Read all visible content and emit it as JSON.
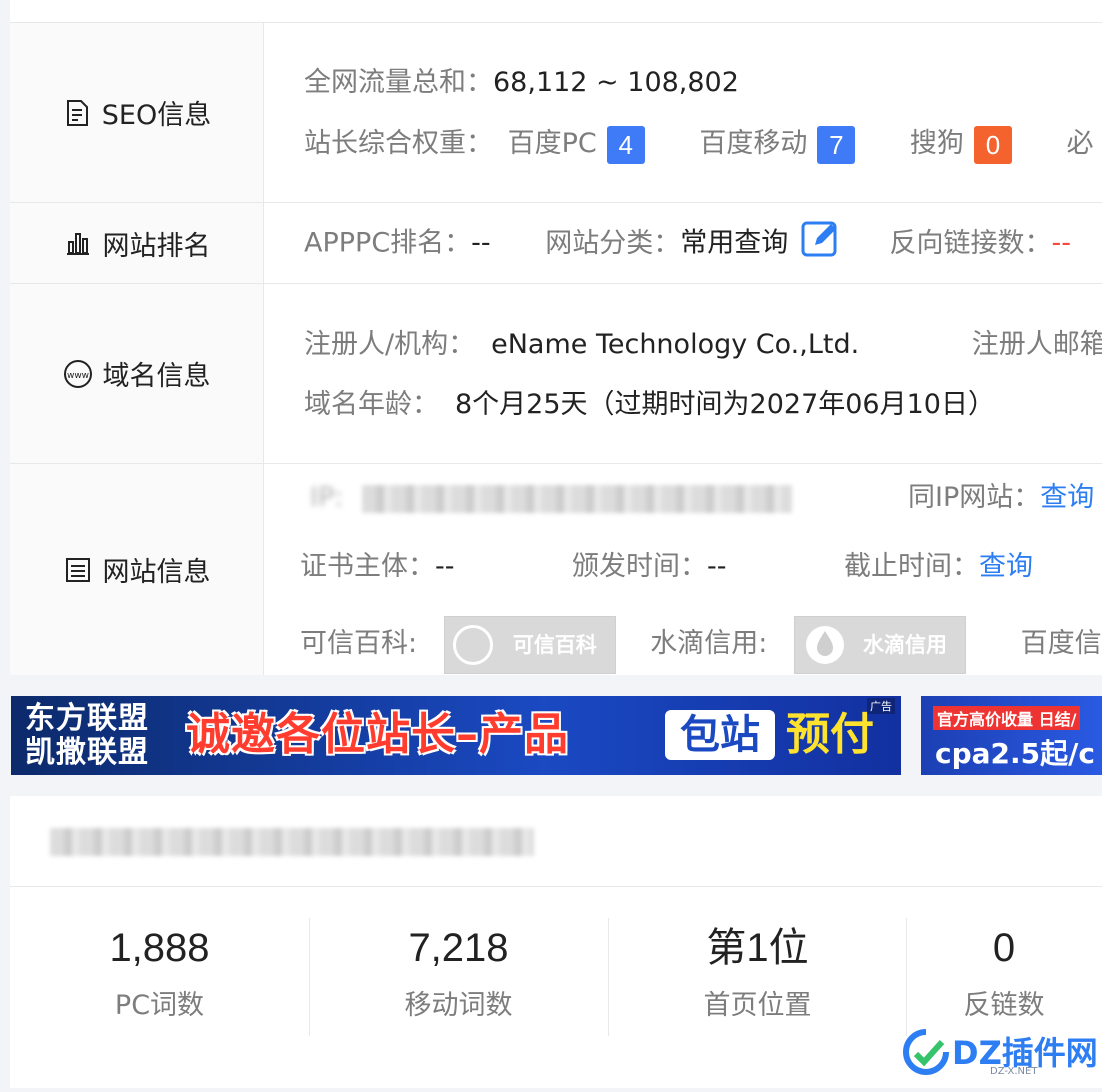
{
  "seo_card": {
    "rows": [
      {
        "label": "SEO信息",
        "icon": "document-icon",
        "lines": [
          {
            "key": "全网流量总和：",
            "value": "68,112 ~ 108,802"
          },
          {
            "key": "站长综合权重：",
            "items": [
              {
                "name": "百度PC",
                "badge": "4",
                "color": "#3f7bf6"
              },
              {
                "name": "百度移动",
                "badge": "7",
                "color": "#3f7bf6"
              },
              {
                "name": "搜狗",
                "badge": "0",
                "color": "#f4622e"
              },
              {
                "name": "必",
                "badge": null
              }
            ]
          }
        ]
      },
      {
        "label": "网站排名",
        "icon": "bar-chart-icon",
        "apppc_label": "APPPC排名：",
        "apppc_value": "--",
        "category_label": "网站分类：",
        "category_value": "常用查询",
        "backlinks_label": "反向链接数：",
        "backlinks_value": "--"
      },
      {
        "label": "域名信息",
        "icon": "www-icon",
        "registrant_label": "注册人/机构：",
        "registrant_value": "eName Technology Co.,Ltd.",
        "email_label": "注册人邮箱",
        "age_label": "域名年龄：",
        "age_value": "8个月25天（过期时间为2027年06月10日）"
      },
      {
        "label": "网站信息",
        "icon": "list-doc-icon",
        "ip_label": "IP:",
        "same_ip_label": "同IP网站：",
        "same_ip_link": "查询",
        "cert_subject_label": "证书主体：",
        "cert_subject_value": "--",
        "issue_time_label": "颁发时间：",
        "issue_time_value": "--",
        "expire_time_label": "截止时间：",
        "expire_time_link": "查询",
        "kexin_label": "可信百科:",
        "kexin_badge": "可信百科",
        "shuidi_label": "水滴信用:",
        "shuidi_badge": "水滴信用",
        "baidu_credit_label": "百度信誉"
      }
    ]
  },
  "banners": {
    "left_line1": "东方联盟",
    "left_line2": "凯撒联盟",
    "main_text": "诚邀各位站长–产品",
    "pill_text": "包站",
    "yellow_text": "预付",
    "ad_tag": "广告",
    "second_top": "官方高价收量 日结/",
    "second_bottom": "cpa2.5起/c"
  },
  "stats": [
    {
      "value": "1,888",
      "caption": "PC词数"
    },
    {
      "value": "7,218",
      "caption": "移动词数"
    },
    {
      "value": "第1位",
      "caption": "首页位置"
    },
    {
      "value": "0",
      "caption": "反链数"
    }
  ],
  "watermark": {
    "text": "DZ插件网",
    "sub": "DZ-X.NET"
  }
}
